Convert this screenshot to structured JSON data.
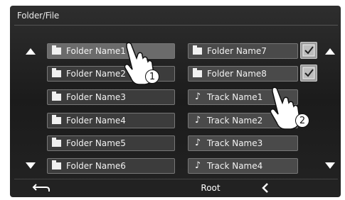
{
  "header": {
    "title": "Folder/File"
  },
  "left_list": [
    {
      "label": "Folder Name1",
      "icon": "folder-icon"
    },
    {
      "label": "Folder Name2",
      "icon": "folder-icon"
    },
    {
      "label": "Folder Name3",
      "icon": "folder-icon"
    },
    {
      "label": "Folder Name4",
      "icon": "folder-icon"
    },
    {
      "label": "Folder Name5",
      "icon": "folder-icon"
    },
    {
      "label": "Folder Name6",
      "icon": "folder-icon"
    }
  ],
  "right_list": [
    {
      "label": "Folder Name7",
      "icon": "folder-icon"
    },
    {
      "label": "Folder Name8",
      "icon": "folder-icon"
    },
    {
      "label": "Track Name1",
      "icon": "music-note-icon"
    },
    {
      "label": "Track Name2",
      "icon": "music-note-icon"
    },
    {
      "label": "Track Name3",
      "icon": "music-note-icon"
    },
    {
      "label": "Track Name4",
      "icon": "music-note-icon"
    }
  ],
  "footer": {
    "back_icon": "return-arrow-icon",
    "root_label": "Root",
    "prev_icon": "chevron-left-icon"
  },
  "callouts": {
    "one": "1",
    "two": "2"
  }
}
